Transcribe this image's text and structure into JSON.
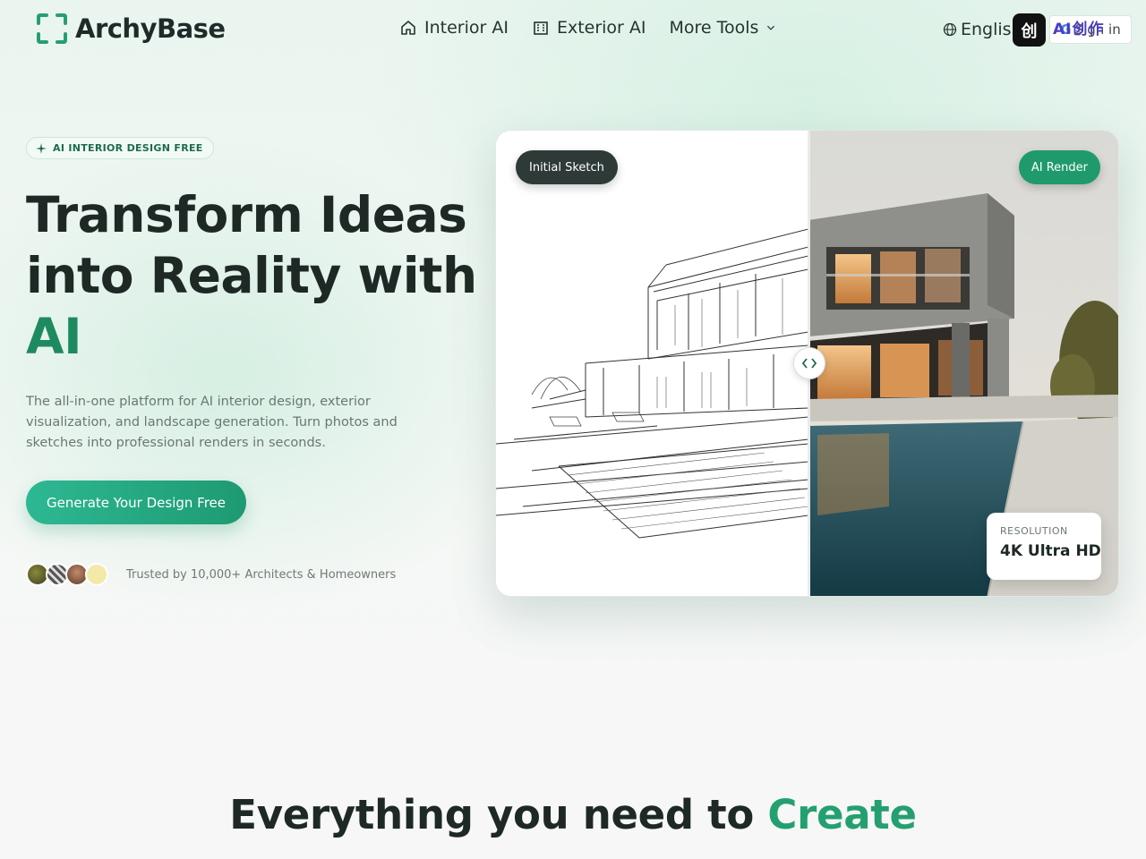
{
  "header": {
    "logo_text": "ArchyBase",
    "nav": [
      {
        "label": "Interior AI",
        "icon": "home-icon"
      },
      {
        "label": "Exterior AI",
        "icon": "building-icon"
      },
      {
        "label": "More Tools",
        "icon": "chevron-down-icon"
      }
    ],
    "language": "English",
    "ext_badge": "创",
    "ext_text": "AI创作",
    "sign_in": "Sign in"
  },
  "hero": {
    "pill": "AI INTERIOR DESIGN FREE",
    "title_line1": "Transform Ideas",
    "title_line2": "into Reality with",
    "title_accent": "AI",
    "description": "The all-in-one platform for AI interior design, exterior visualization, and landscape generation. Turn photos and sketches into professional renders in seconds.",
    "cta": "Generate Your Design Free",
    "trust": "Trusted by 10,000+ Architects & Homeowners"
  },
  "compare": {
    "left_tag": "Initial Sketch",
    "right_tag": "AI Render",
    "resolution_label": "RESOLUTION",
    "resolution_value": "4K Ultra HD"
  },
  "section": {
    "title_main": "Everything you need to",
    "title_accent": "Create"
  },
  "colors": {
    "brand": "#1e8a60",
    "accent_green": "#1f9a6c",
    "dark_tag": "#2e3a37"
  }
}
